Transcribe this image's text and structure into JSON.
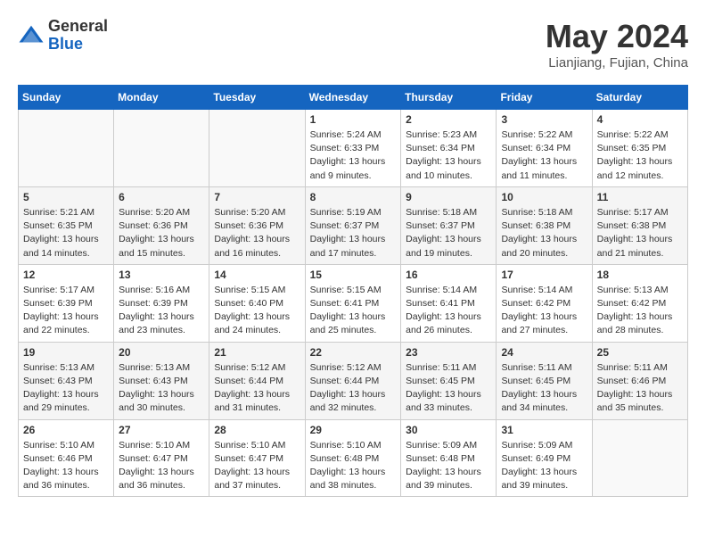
{
  "logo": {
    "general": "General",
    "blue": "Blue"
  },
  "title": {
    "month_year": "May 2024",
    "location": "Lianjiang, Fujian, China"
  },
  "weekdays": [
    "Sunday",
    "Monday",
    "Tuesday",
    "Wednesday",
    "Thursday",
    "Friday",
    "Saturday"
  ],
  "weeks": [
    [
      {
        "day": "",
        "sunrise": "",
        "sunset": "",
        "daylight": ""
      },
      {
        "day": "",
        "sunrise": "",
        "sunset": "",
        "daylight": ""
      },
      {
        "day": "",
        "sunrise": "",
        "sunset": "",
        "daylight": ""
      },
      {
        "day": "1",
        "sunrise": "5:24 AM",
        "sunset": "6:33 PM",
        "daylight": "13 hours and 9 minutes."
      },
      {
        "day": "2",
        "sunrise": "5:23 AM",
        "sunset": "6:34 PM",
        "daylight": "13 hours and 10 minutes."
      },
      {
        "day": "3",
        "sunrise": "5:22 AM",
        "sunset": "6:34 PM",
        "daylight": "13 hours and 11 minutes."
      },
      {
        "day": "4",
        "sunrise": "5:22 AM",
        "sunset": "6:35 PM",
        "daylight": "13 hours and 12 minutes."
      }
    ],
    [
      {
        "day": "5",
        "sunrise": "5:21 AM",
        "sunset": "6:35 PM",
        "daylight": "13 hours and 14 minutes."
      },
      {
        "day": "6",
        "sunrise": "5:20 AM",
        "sunset": "6:36 PM",
        "daylight": "13 hours and 15 minutes."
      },
      {
        "day": "7",
        "sunrise": "5:20 AM",
        "sunset": "6:36 PM",
        "daylight": "13 hours and 16 minutes."
      },
      {
        "day": "8",
        "sunrise": "5:19 AM",
        "sunset": "6:37 PM",
        "daylight": "13 hours and 17 minutes."
      },
      {
        "day": "9",
        "sunrise": "5:18 AM",
        "sunset": "6:37 PM",
        "daylight": "13 hours and 19 minutes."
      },
      {
        "day": "10",
        "sunrise": "5:18 AM",
        "sunset": "6:38 PM",
        "daylight": "13 hours and 20 minutes."
      },
      {
        "day": "11",
        "sunrise": "5:17 AM",
        "sunset": "6:38 PM",
        "daylight": "13 hours and 21 minutes."
      }
    ],
    [
      {
        "day": "12",
        "sunrise": "5:17 AM",
        "sunset": "6:39 PM",
        "daylight": "13 hours and 22 minutes."
      },
      {
        "day": "13",
        "sunrise": "5:16 AM",
        "sunset": "6:39 PM",
        "daylight": "13 hours and 23 minutes."
      },
      {
        "day": "14",
        "sunrise": "5:15 AM",
        "sunset": "6:40 PM",
        "daylight": "13 hours and 24 minutes."
      },
      {
        "day": "15",
        "sunrise": "5:15 AM",
        "sunset": "6:41 PM",
        "daylight": "13 hours and 25 minutes."
      },
      {
        "day": "16",
        "sunrise": "5:14 AM",
        "sunset": "6:41 PM",
        "daylight": "13 hours and 26 minutes."
      },
      {
        "day": "17",
        "sunrise": "5:14 AM",
        "sunset": "6:42 PM",
        "daylight": "13 hours and 27 minutes."
      },
      {
        "day": "18",
        "sunrise": "5:13 AM",
        "sunset": "6:42 PM",
        "daylight": "13 hours and 28 minutes."
      }
    ],
    [
      {
        "day": "19",
        "sunrise": "5:13 AM",
        "sunset": "6:43 PM",
        "daylight": "13 hours and 29 minutes."
      },
      {
        "day": "20",
        "sunrise": "5:13 AM",
        "sunset": "6:43 PM",
        "daylight": "13 hours and 30 minutes."
      },
      {
        "day": "21",
        "sunrise": "5:12 AM",
        "sunset": "6:44 PM",
        "daylight": "13 hours and 31 minutes."
      },
      {
        "day": "22",
        "sunrise": "5:12 AM",
        "sunset": "6:44 PM",
        "daylight": "13 hours and 32 minutes."
      },
      {
        "day": "23",
        "sunrise": "5:11 AM",
        "sunset": "6:45 PM",
        "daylight": "13 hours and 33 minutes."
      },
      {
        "day": "24",
        "sunrise": "5:11 AM",
        "sunset": "6:45 PM",
        "daylight": "13 hours and 34 minutes."
      },
      {
        "day": "25",
        "sunrise": "5:11 AM",
        "sunset": "6:46 PM",
        "daylight": "13 hours and 35 minutes."
      }
    ],
    [
      {
        "day": "26",
        "sunrise": "5:10 AM",
        "sunset": "6:46 PM",
        "daylight": "13 hours and 36 minutes."
      },
      {
        "day": "27",
        "sunrise": "5:10 AM",
        "sunset": "6:47 PM",
        "daylight": "13 hours and 36 minutes."
      },
      {
        "day": "28",
        "sunrise": "5:10 AM",
        "sunset": "6:47 PM",
        "daylight": "13 hours and 37 minutes."
      },
      {
        "day": "29",
        "sunrise": "5:10 AM",
        "sunset": "6:48 PM",
        "daylight": "13 hours and 38 minutes."
      },
      {
        "day": "30",
        "sunrise": "5:09 AM",
        "sunset": "6:48 PM",
        "daylight": "13 hours and 39 minutes."
      },
      {
        "day": "31",
        "sunrise": "5:09 AM",
        "sunset": "6:49 PM",
        "daylight": "13 hours and 39 minutes."
      },
      {
        "day": "",
        "sunrise": "",
        "sunset": "",
        "daylight": ""
      }
    ]
  ]
}
